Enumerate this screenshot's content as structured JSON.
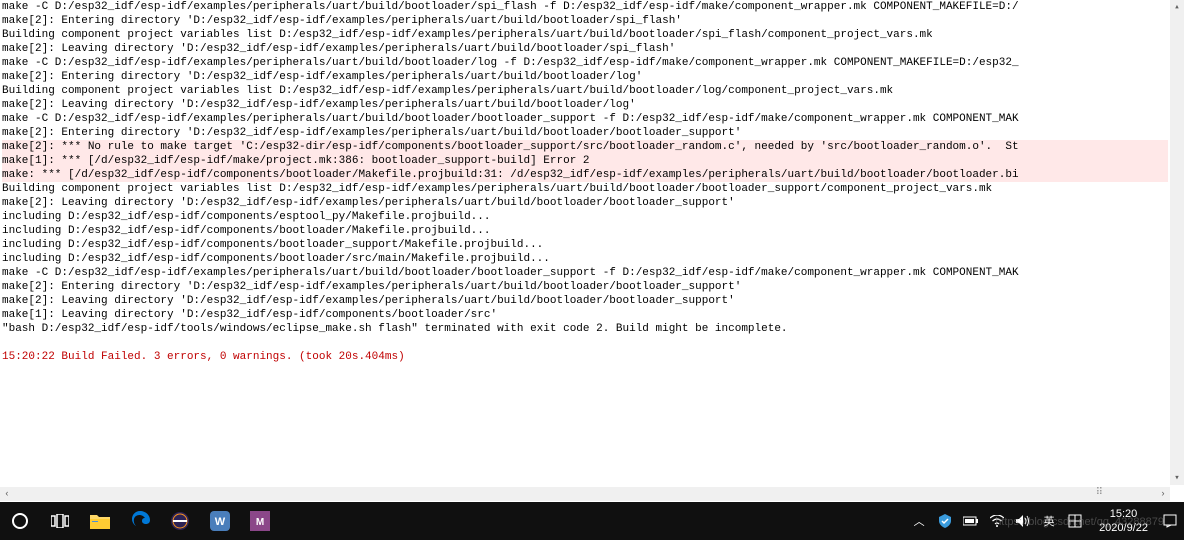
{
  "console": {
    "lines": [
      {
        "t": "make -C D:/esp32_idf/esp-idf/examples/peripherals/uart/build/bootloader/spi_flash -f D:/esp32_idf/esp-idf/make/component_wrapper.mk COMPONENT_MAKEFILE=D:/",
        "c": "line"
      },
      {
        "t": "make[2]: Entering directory 'D:/esp32_idf/esp-idf/examples/peripherals/uart/build/bootloader/spi_flash'",
        "c": "line"
      },
      {
        "t": "Building component project variables list D:/esp32_idf/esp-idf/examples/peripherals/uart/build/bootloader/spi_flash/component_project_vars.mk",
        "c": "line"
      },
      {
        "t": "make[2]: Leaving directory 'D:/esp32_idf/esp-idf/examples/peripherals/uart/build/bootloader/spi_flash'",
        "c": "line"
      },
      {
        "t": "make -C D:/esp32_idf/esp-idf/examples/peripherals/uart/build/bootloader/log -f D:/esp32_idf/esp-idf/make/component_wrapper.mk COMPONENT_MAKEFILE=D:/esp32_",
        "c": "line"
      },
      {
        "t": "make[2]: Entering directory 'D:/esp32_idf/esp-idf/examples/peripherals/uart/build/bootloader/log'",
        "c": "line"
      },
      {
        "t": "Building component project variables list D:/esp32_idf/esp-idf/examples/peripherals/uart/build/bootloader/log/component_project_vars.mk",
        "c": "line"
      },
      {
        "t": "make[2]: Leaving directory 'D:/esp32_idf/esp-idf/examples/peripherals/uart/build/bootloader/log'",
        "c": "line"
      },
      {
        "t": "make -C D:/esp32_idf/esp-idf/examples/peripherals/uart/build/bootloader/bootloader_support -f D:/esp32_idf/esp-idf/make/component_wrapper.mk COMPONENT_MAK",
        "c": "line"
      },
      {
        "t": "make[2]: Entering directory 'D:/esp32_idf/esp-idf/examples/peripherals/uart/build/bootloader/bootloader_support'",
        "c": "line"
      },
      {
        "t": "make[2]: *** No rule to make target 'C:/esp32-dir/esp-idf/components/bootloader_support/src/bootloader_random.c', needed by 'src/bootloader_random.o'.  St",
        "c": "line-error"
      },
      {
        "t": "make[1]: *** [/d/esp32_idf/esp-idf/make/project.mk:386: bootloader_support-build] Error 2",
        "c": "line-error"
      },
      {
        "t": "make: *** [/d/esp32_idf/esp-idf/components/bootloader/Makefile.projbuild:31: /d/esp32_idf/esp-idf/examples/peripherals/uart/build/bootloader/bootloader.bi",
        "c": "line-error"
      },
      {
        "t": "Building component project variables list D:/esp32_idf/esp-idf/examples/peripherals/uart/build/bootloader/bootloader_support/component_project_vars.mk",
        "c": "line"
      },
      {
        "t": "make[2]: Leaving directory 'D:/esp32_idf/esp-idf/examples/peripherals/uart/build/bootloader/bootloader_support'",
        "c": "line"
      },
      {
        "t": "including D:/esp32_idf/esp-idf/components/esptool_py/Makefile.projbuild...",
        "c": "line"
      },
      {
        "t": "including D:/esp32_idf/esp-idf/components/bootloader/Makefile.projbuild...",
        "c": "line"
      },
      {
        "t": "including D:/esp32_idf/esp-idf/components/bootloader_support/Makefile.projbuild...",
        "c": "line"
      },
      {
        "t": "including D:/esp32_idf/esp-idf/components/bootloader/src/main/Makefile.projbuild...",
        "c": "line"
      },
      {
        "t": "make -C D:/esp32_idf/esp-idf/examples/peripherals/uart/build/bootloader/bootloader_support -f D:/esp32_idf/esp-idf/make/component_wrapper.mk COMPONENT_MAK",
        "c": "line"
      },
      {
        "t": "make[2]: Entering directory 'D:/esp32_idf/esp-idf/examples/peripherals/uart/build/bootloader/bootloader_support'",
        "c": "line"
      },
      {
        "t": "make[2]: Leaving directory 'D:/esp32_idf/esp-idf/examples/peripherals/uart/build/bootloader/bootloader_support'",
        "c": "line"
      },
      {
        "t": "make[1]: Leaving directory 'D:/esp32_idf/esp-idf/components/bootloader/src'",
        "c": "line"
      },
      {
        "t": "\"bash D:/esp32_idf/esp-idf/tools/windows/eclipse_make.sh flash\" terminated with exit code 2. Build might be incomplete.",
        "c": "line"
      },
      {
        "t": "",
        "c": "line"
      },
      {
        "t": "15:20:22 Build Failed. 3 errors, 0 warnings. (took 20s.404ms)",
        "c": "line-status"
      },
      {
        "t": "",
        "c": "line"
      }
    ]
  },
  "scroll": {
    "up_glyph": "▴",
    "down_glyph": "▾",
    "left_glyph": "‹",
    "right_glyph": "›"
  },
  "taskbar": {
    "cortana": "O",
    "time": "15:20",
    "date": "2020/9/22",
    "ime": "英",
    "notif_count": "囲"
  },
  "watermark": "https://blog.csdn.net/qq_43288879"
}
